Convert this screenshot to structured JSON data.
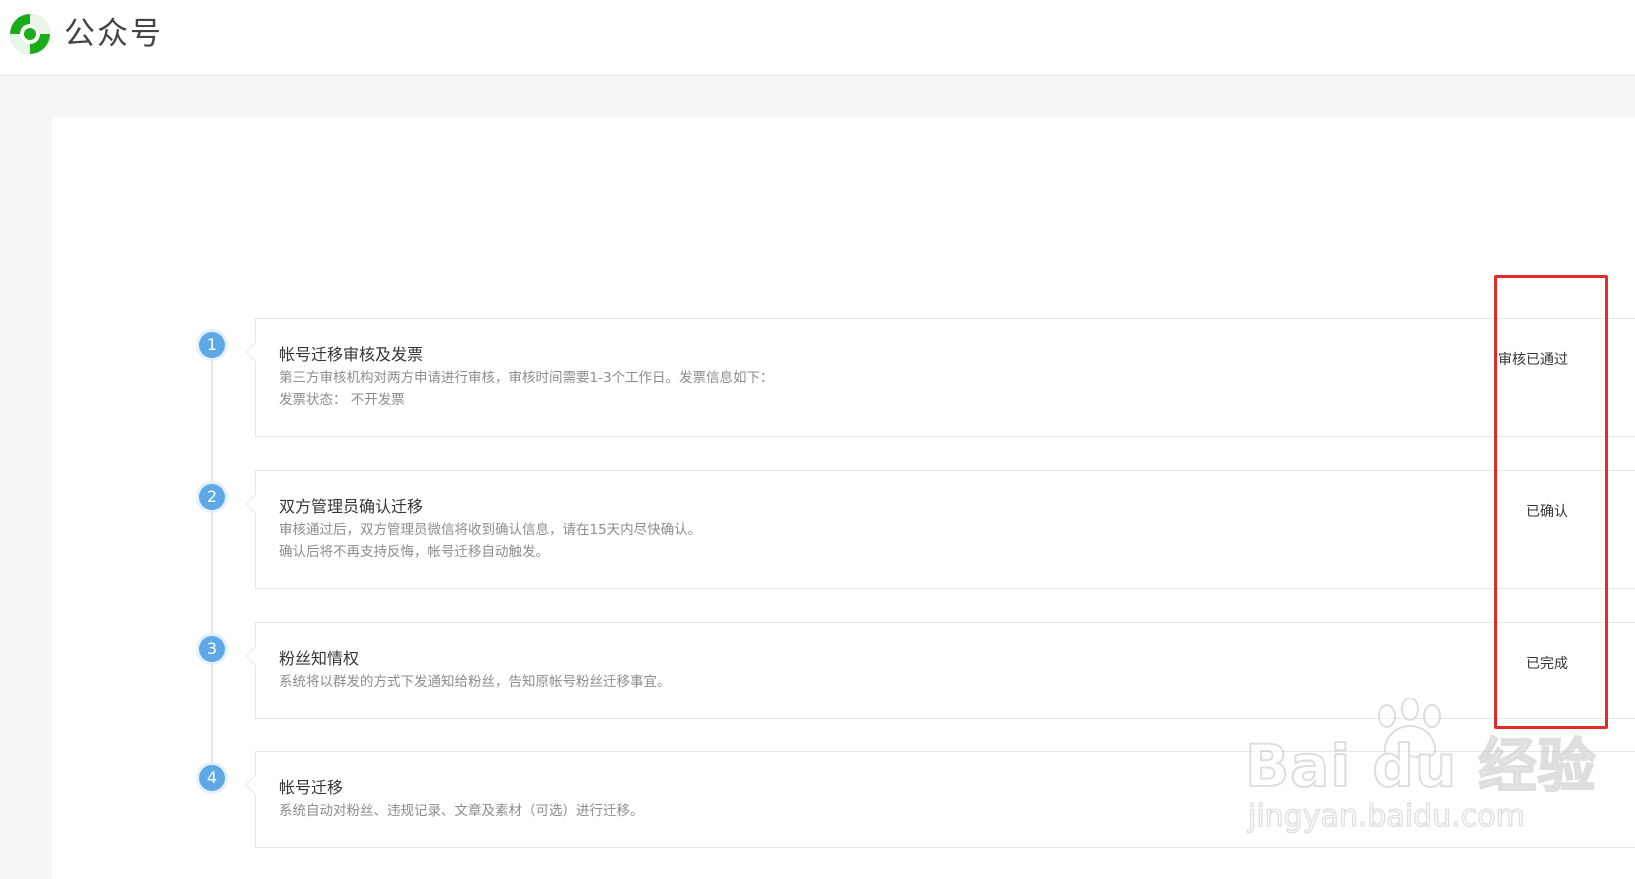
{
  "header": {
    "brand": "公众号",
    "logo_icon": "wechat-official-account-logo-icon",
    "logo_color": "#1aad19"
  },
  "steps": [
    {
      "number": "1",
      "title": "帐号迁移审核及发票",
      "lines": [
        "第三方审核机构对两方申请进行审核，审核时间需要1-3个工作日。发票信息如下：",
        "发票状态：  不开发票"
      ],
      "status": "审核已通过"
    },
    {
      "number": "2",
      "title": "双方管理员确认迁移",
      "lines": [
        "审核通过后，双方管理员微信将收到确认信息，请在15天内尽快确认。",
        "确认后将不再支持反悔，帐号迁移自动触发。"
      ],
      "status": "已确认"
    },
    {
      "number": "3",
      "title": "粉丝知情权",
      "lines": [
        "系统将以群发的方式下发通知给粉丝，告知原帐号粉丝迁移事宜。"
      ],
      "status": "已完成"
    },
    {
      "number": "4",
      "title": "帐号迁移",
      "lines": [
        "系统自动对粉丝、违规记录、文章及素材（可选）进行迁移。"
      ],
      "status": ""
    }
  ],
  "watermark": {
    "brand": "Bai du 经验",
    "url": "jingyan.baidu.com",
    "icon": "baidu-paw-icon"
  },
  "colors": {
    "step_badge": "#5fa8e6",
    "highlight_box": "#e52a2a"
  }
}
